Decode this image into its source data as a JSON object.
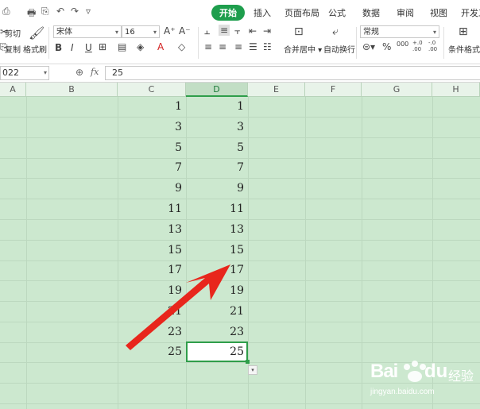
{
  "quick_access": [
    "⎙",
    "🖶",
    "⎘",
    "↶",
    "↷",
    "▿"
  ],
  "tabs": [
    {
      "label": "开始",
      "active": true
    },
    {
      "label": "插入"
    },
    {
      "label": "页面布局"
    },
    {
      "label": "公式"
    },
    {
      "label": "数据"
    },
    {
      "label": "审阅"
    },
    {
      "label": "视图"
    },
    {
      "label": "开发工"
    }
  ],
  "ribbon": {
    "cut_label": "剪切",
    "copy_label": "复制",
    "format_painter_label": "格式刷",
    "font_name": "宋体",
    "font_size": "16",
    "bold": "B",
    "italic": "I",
    "underline": "U",
    "merge_label": "合并居中",
    "wrap_label": "自动换行",
    "number_format": "常规",
    "conditional_format_label": "条件格式",
    "percent": "%",
    "thousands": "000",
    "inc_decimal": "+.0\n.00",
    "dec_decimal": "-.0\n.00"
  },
  "formula_bar": {
    "name_box": "022",
    "fx": "fx",
    "value": "25"
  },
  "columns": [
    "A",
    "B",
    "C",
    "D",
    "E",
    "F",
    "G",
    "H"
  ],
  "selected_column": "D",
  "rows": [
    {
      "c": "1",
      "d": "1"
    },
    {
      "c": "3",
      "d": "3"
    },
    {
      "c": "5",
      "d": "5"
    },
    {
      "c": "7",
      "d": "7"
    },
    {
      "c": "9",
      "d": "9"
    },
    {
      "c": "11",
      "d": "11"
    },
    {
      "c": "13",
      "d": "13"
    },
    {
      "c": "15",
      "d": "15"
    },
    {
      "c": "17",
      "d": "17"
    },
    {
      "c": "19",
      "d": "19"
    },
    {
      "c": "21",
      "d": "21"
    },
    {
      "c": "23",
      "d": "23"
    },
    {
      "c": "25",
      "d": "25"
    }
  ],
  "watermark": {
    "brand": "Bai",
    "brand2": "du",
    "suffix": "经验",
    "url": "jingyan.baidu.com"
  },
  "colors": {
    "accent": "#1e9e4d",
    "grid_bg": "#cce8cf",
    "arrow": "#e8261c"
  }
}
